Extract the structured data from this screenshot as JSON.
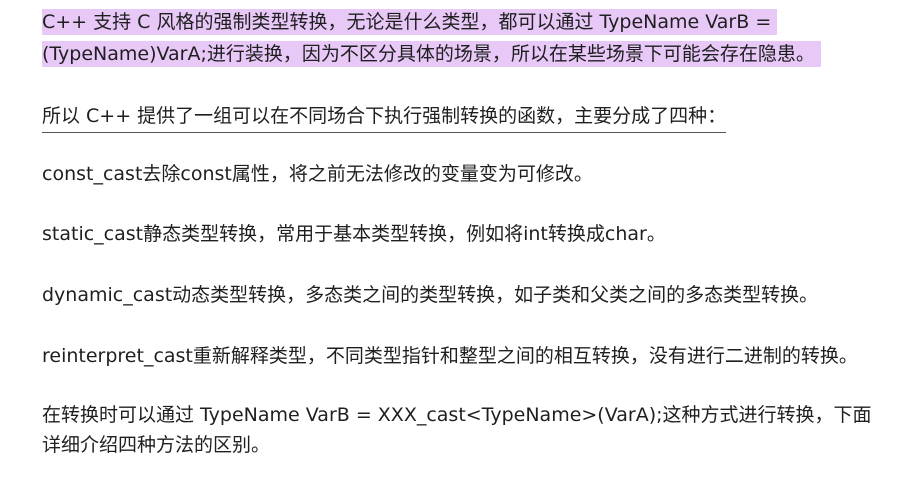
{
  "paragraphs": {
    "p1_line1": "C++ 支持 C 风格的强制类型转换，无论是什么类型，都可以通过 TypeName VarB =",
    "p1_line2": "(TypeName)VarA;进行装换，因为不区分具体的场景，所以在某些场景下可能会存在隐患。",
    "p2": "所以 C++ 提供了一组可以在不同场合下执行强制转换的函数，主要分成了四种：",
    "p3": "const_cast去除const属性，将之前无法修改的变量变为可修改。",
    "p4": "static_cast静态类型转换，常用于基本类型转换，例如将int转换成char。",
    "p5": "dynamic_cast动态类型转换，多态类之间的类型转换，如子类和父类之间的多态类型转换。",
    "p6": "reinterpret_cast重新解释类型，不同类型指针和整型之间的相互转换，没有进行二进制的转换。",
    "p7_line1": "在转换时可以通过 TypeName VarB = XXX_cast<TypeName>(VarA);这种方式进行转换，下面",
    "p7_line2": "详细介绍四种方法的区别。"
  },
  "colors": {
    "highlight": "#e7c8f7",
    "text": "#1f1f1f"
  }
}
